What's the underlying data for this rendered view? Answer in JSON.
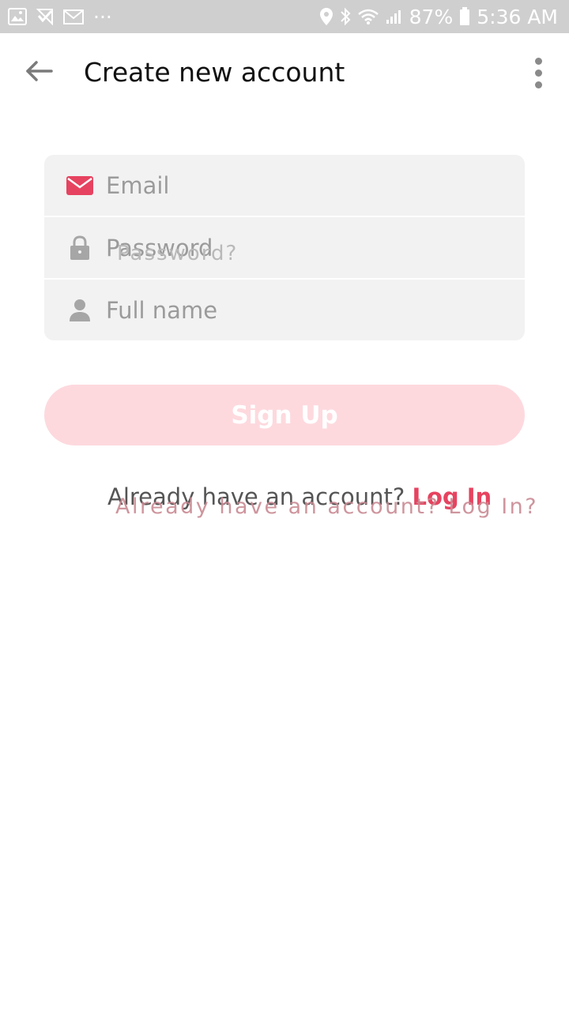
{
  "status_bar": {
    "more_indicator": "···",
    "battery": "87%",
    "time": "5:36 AM"
  },
  "header": {
    "title": "Create new account"
  },
  "form": {
    "email_placeholder": "Email",
    "password_placeholder": "Password",
    "fullname_placeholder": "Full name",
    "password_overlay": "Password?"
  },
  "signup_button": {
    "label": "Sign Up"
  },
  "login_prompt": {
    "text": "Already have an account? ",
    "link": "Log In",
    "overlay": "Already have an account? Log In?"
  },
  "colors": {
    "accent": "#e64360",
    "button_disabled": "#fdd9de",
    "status_bar_bg": "#cfcfcf",
    "field_bg": "#f2f2f2"
  },
  "icons": {
    "back": "arrow-left-icon",
    "menu": "more-vertical-icon",
    "email": "mail-icon",
    "password": "lock-icon",
    "name": "person-icon"
  }
}
